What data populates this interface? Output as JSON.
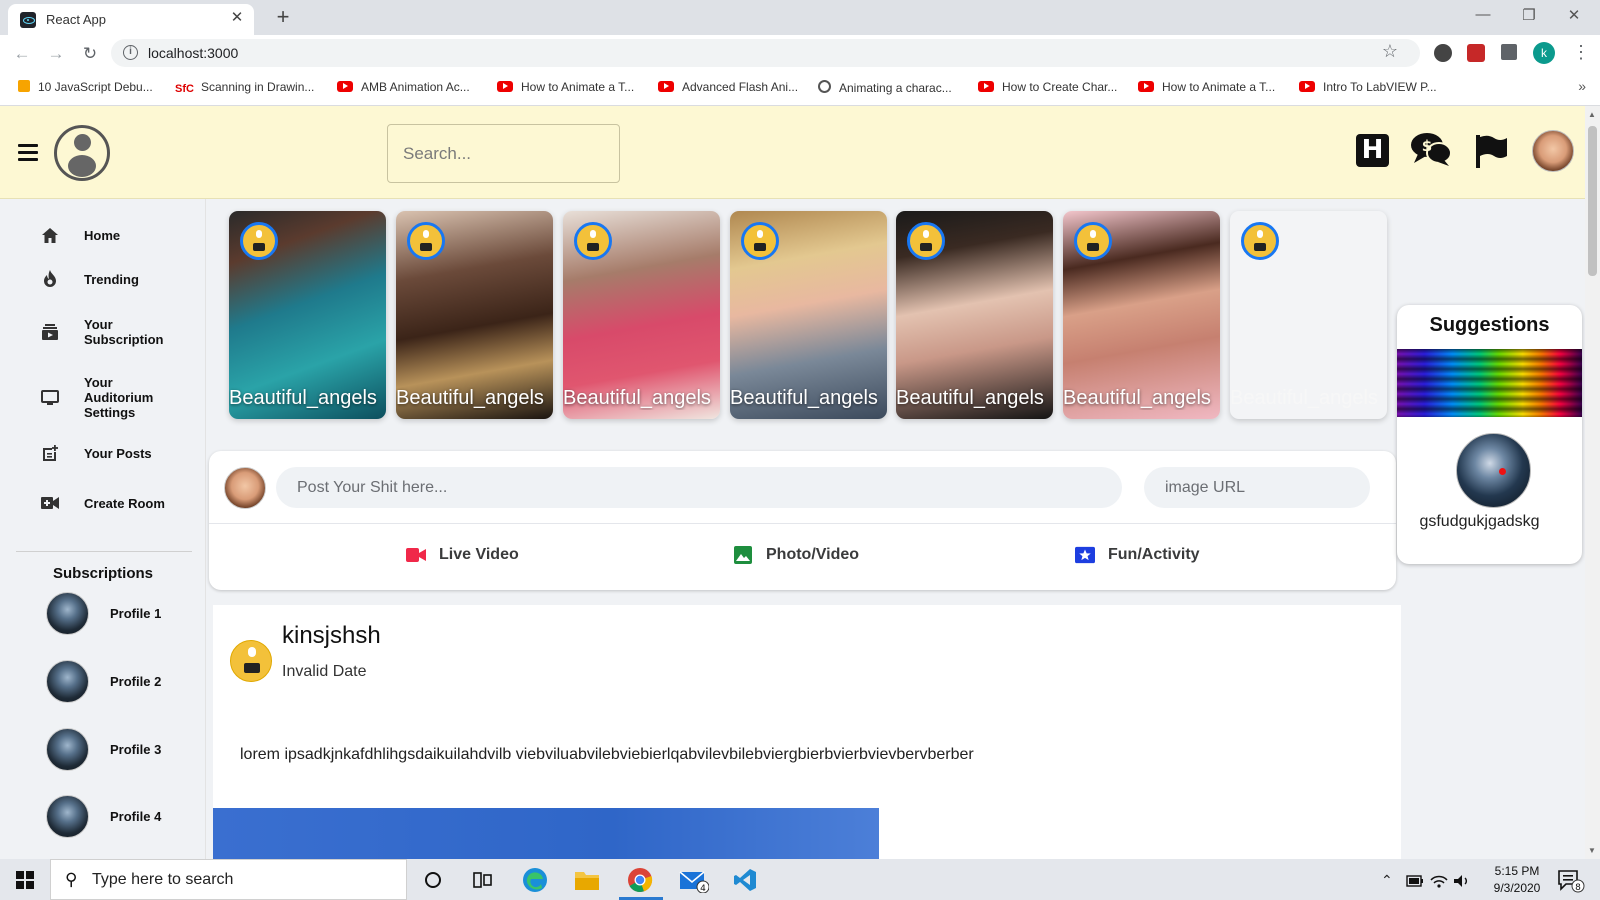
{
  "browser": {
    "tab_title": "React App",
    "tab_close": "✕",
    "new_tab": "+",
    "url": "localhost:3000",
    "profile_initial": "k",
    "bookmarks": [
      {
        "label": "10 JavaScript Debu...",
        "icon": "js-icon"
      },
      {
        "label": "Scanning in Drawin...",
        "icon": "sfc-icon"
      },
      {
        "label": "AMB Animation Ac...",
        "icon": "youtube-icon"
      },
      {
        "label": "How to Animate a T...",
        "icon": "youtube-icon"
      },
      {
        "label": "Advanced Flash Ani...",
        "icon": "youtube-icon"
      },
      {
        "label": "Animating a charac...",
        "icon": "globe-icon"
      },
      {
        "label": "How to Create Char...",
        "icon": "youtube-icon"
      },
      {
        "label": "How to Animate a T...",
        "icon": "youtube-icon"
      },
      {
        "label": "Intro To LabVIEW P...",
        "icon": "youtube-icon"
      }
    ],
    "bookmark_sfc_text": "SfC"
  },
  "header": {
    "search_placeholder": "Search...",
    "h_icon_letter": "H",
    "colors": {
      "background": "#fdf8d3"
    }
  },
  "sidebar": {
    "items": [
      {
        "label": "Home",
        "icon": "home-icon"
      },
      {
        "label": "Trending",
        "icon": "fire-icon"
      },
      {
        "label": "Your Subscription",
        "icon": "subscription-icon"
      },
      {
        "label": "Your Auditorium Settings",
        "icon": "monitor-icon"
      },
      {
        "label": "Your Posts",
        "icon": "post-add-icon"
      },
      {
        "label": "Create Room",
        "icon": "video-call-icon"
      }
    ],
    "subscriptions_title": "Subscriptions",
    "subscriptions": [
      {
        "label": "Profile 1"
      },
      {
        "label": "Profile 2"
      },
      {
        "label": "Profile 3"
      },
      {
        "label": "Profile 4"
      }
    ]
  },
  "stories": [
    {
      "name": "Beautiful_angels",
      "bg": "linear-gradient(160deg,#2a2a2a 0%,#5b3b2e 20%,#1f7a8c 45%,#2aa3a8 70%,#0d4f5e 100%)"
    },
    {
      "name": "Beautiful_angels",
      "bg": "linear-gradient(170deg,#d9c2b0 0%,#6b4a3a 30%,#3b2418 55%,#b8925a 75%,#1a1410 100%)"
    },
    {
      "name": "Beautiful_angels",
      "bg": "linear-gradient(170deg,#e8dfd8 0%,#a67c6a 30%,#d84a6a 55%,#e0566f 75%,#f0e6e0 100%)"
    },
    {
      "name": "Beautiful_angels",
      "bg": "linear-gradient(170deg,#b08850 0%,#e3c890 25%,#e8b8a0 45%,#7a8898 70%,#3c4a5c 100%)"
    },
    {
      "name": "Beautiful_angels",
      "bg": "linear-gradient(170deg,#1a1a1a 0%,#3a2a22 20%,#e3c2b0 45%,#c99888 65%,#141414 100%)"
    },
    {
      "name": "Beautiful_angels",
      "bg": "linear-gradient(170deg,#f3c6cc 0%,#4a2a20 25%,#d9a088 45%,#c68070 65%,#f0b8c2 100%)"
    },
    {
      "name": "Beautiful_angels",
      "bg": "#f3f4f6"
    }
  ],
  "composer": {
    "post_placeholder": "Post Your Shit here...",
    "image_placeholder": "image URL",
    "options": [
      {
        "label": "Live Video",
        "icon": "live-video-icon",
        "color": "#f02849"
      },
      {
        "label": "Photo/Video",
        "icon": "photo-icon",
        "color": "#45bd62"
      },
      {
        "label": "Fun/Activity",
        "icon": "activity-icon",
        "color": "#1d3ee0"
      }
    ]
  },
  "suggestions": {
    "title": "Suggestions",
    "name": "gsfudgukjgadskg"
  },
  "post": {
    "author": "kinsjshsh",
    "date": "Invalid Date",
    "text": "lorem ipsadkjnkafdhlihgsdaikuilahdvilb viebviluabvilebviebierlqabvilevbilebviergbierbvierbvievbervberber"
  },
  "taskbar": {
    "search_placeholder": "Type here to search",
    "time": "5:15 PM",
    "date": "9/3/2020",
    "mail_badge": "4",
    "notif_badge": "8"
  }
}
